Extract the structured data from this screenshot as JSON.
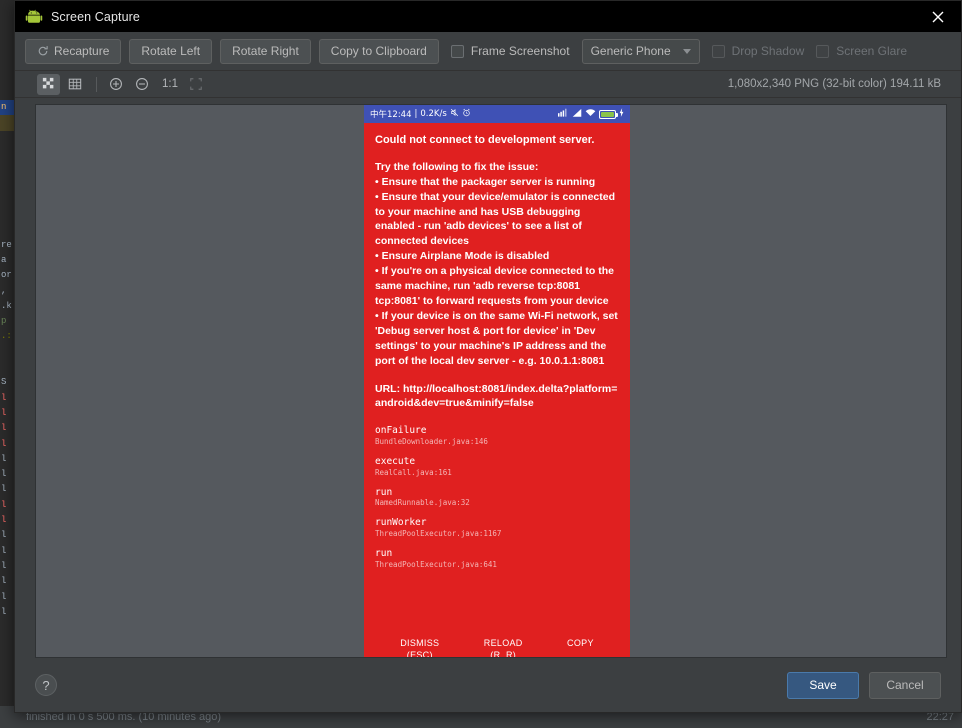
{
  "window": {
    "title": "Screen Capture",
    "icon": "android-icon",
    "close_label": "✕"
  },
  "toolbar": {
    "recapture_label": "Recapture",
    "rotate_left_label": "Rotate Left",
    "rotate_right_label": "Rotate Right",
    "copy_clipboard_label": "Copy to Clipboard",
    "frame_screenshot_label": "Frame Screenshot",
    "device_select_value": "Generic Phone",
    "drop_shadow_label": "Drop Shadow",
    "screen_glare_label": "Screen Glare"
  },
  "view_toolbar": {
    "zoom_ratio_label": "1:1",
    "image_info": "1,080x2,340 PNG (32-bit color) 194.11 kB"
  },
  "screenshot": {
    "status_bar": {
      "time": "中午12:44",
      "separator": "|",
      "network_speed": "0.2K/s"
    },
    "error": {
      "title": "Could not connect to development server.",
      "intro": "Try the following to fix the issue:",
      "bullets": [
        "• Ensure that the packager server is running",
        "• Ensure that your device/emulator is connected to your machine and has USB debugging enabled - run 'adb devices' to see a list of connected devices",
        "• Ensure Airplane Mode is disabled",
        "• If you're on a physical device connected to the same machine, run 'adb reverse tcp:8081 tcp:8081' to forward requests from your device",
        "• If your device is on the same Wi-Fi network, set 'Debug server host & port for device' in 'Dev settings' to your machine's IP address and the port of the local dev server - e.g. 10.0.1.1:8081"
      ],
      "url": "URL: http://localhost:8081/index.delta?platform=android&dev=true&minify=false",
      "stack": [
        {
          "method": "onFailure",
          "file": "BundleDownloader.java:146"
        },
        {
          "method": "execute",
          "file": "RealCall.java:161"
        },
        {
          "method": "run",
          "file": "NamedRunnable.java:32"
        },
        {
          "method": "runWorker",
          "file": "ThreadPoolExecutor.java:1167"
        },
        {
          "method": "run",
          "file": "ThreadPoolExecutor.java:641"
        }
      ],
      "actions": [
        {
          "label": "DISMISS",
          "hint": "(ESC)"
        },
        {
          "label": "RELOAD",
          "hint": "(R, R)"
        },
        {
          "label": "COPY",
          "hint": ""
        }
      ]
    }
  },
  "footer": {
    "help_label": "?",
    "save_label": "Save",
    "cancel_label": "Cancel"
  },
  "ide_background": {
    "status_text": "finished in 0 s 500 ms. (10 minutes ago)",
    "clock": "22:27"
  },
  "colors": {
    "error_red": "#e02020",
    "status_bar_blue": "#3f51b5",
    "accent_blue": "#365880",
    "canvas_gray": "#55595e",
    "panel_gray": "#3c3f41"
  }
}
